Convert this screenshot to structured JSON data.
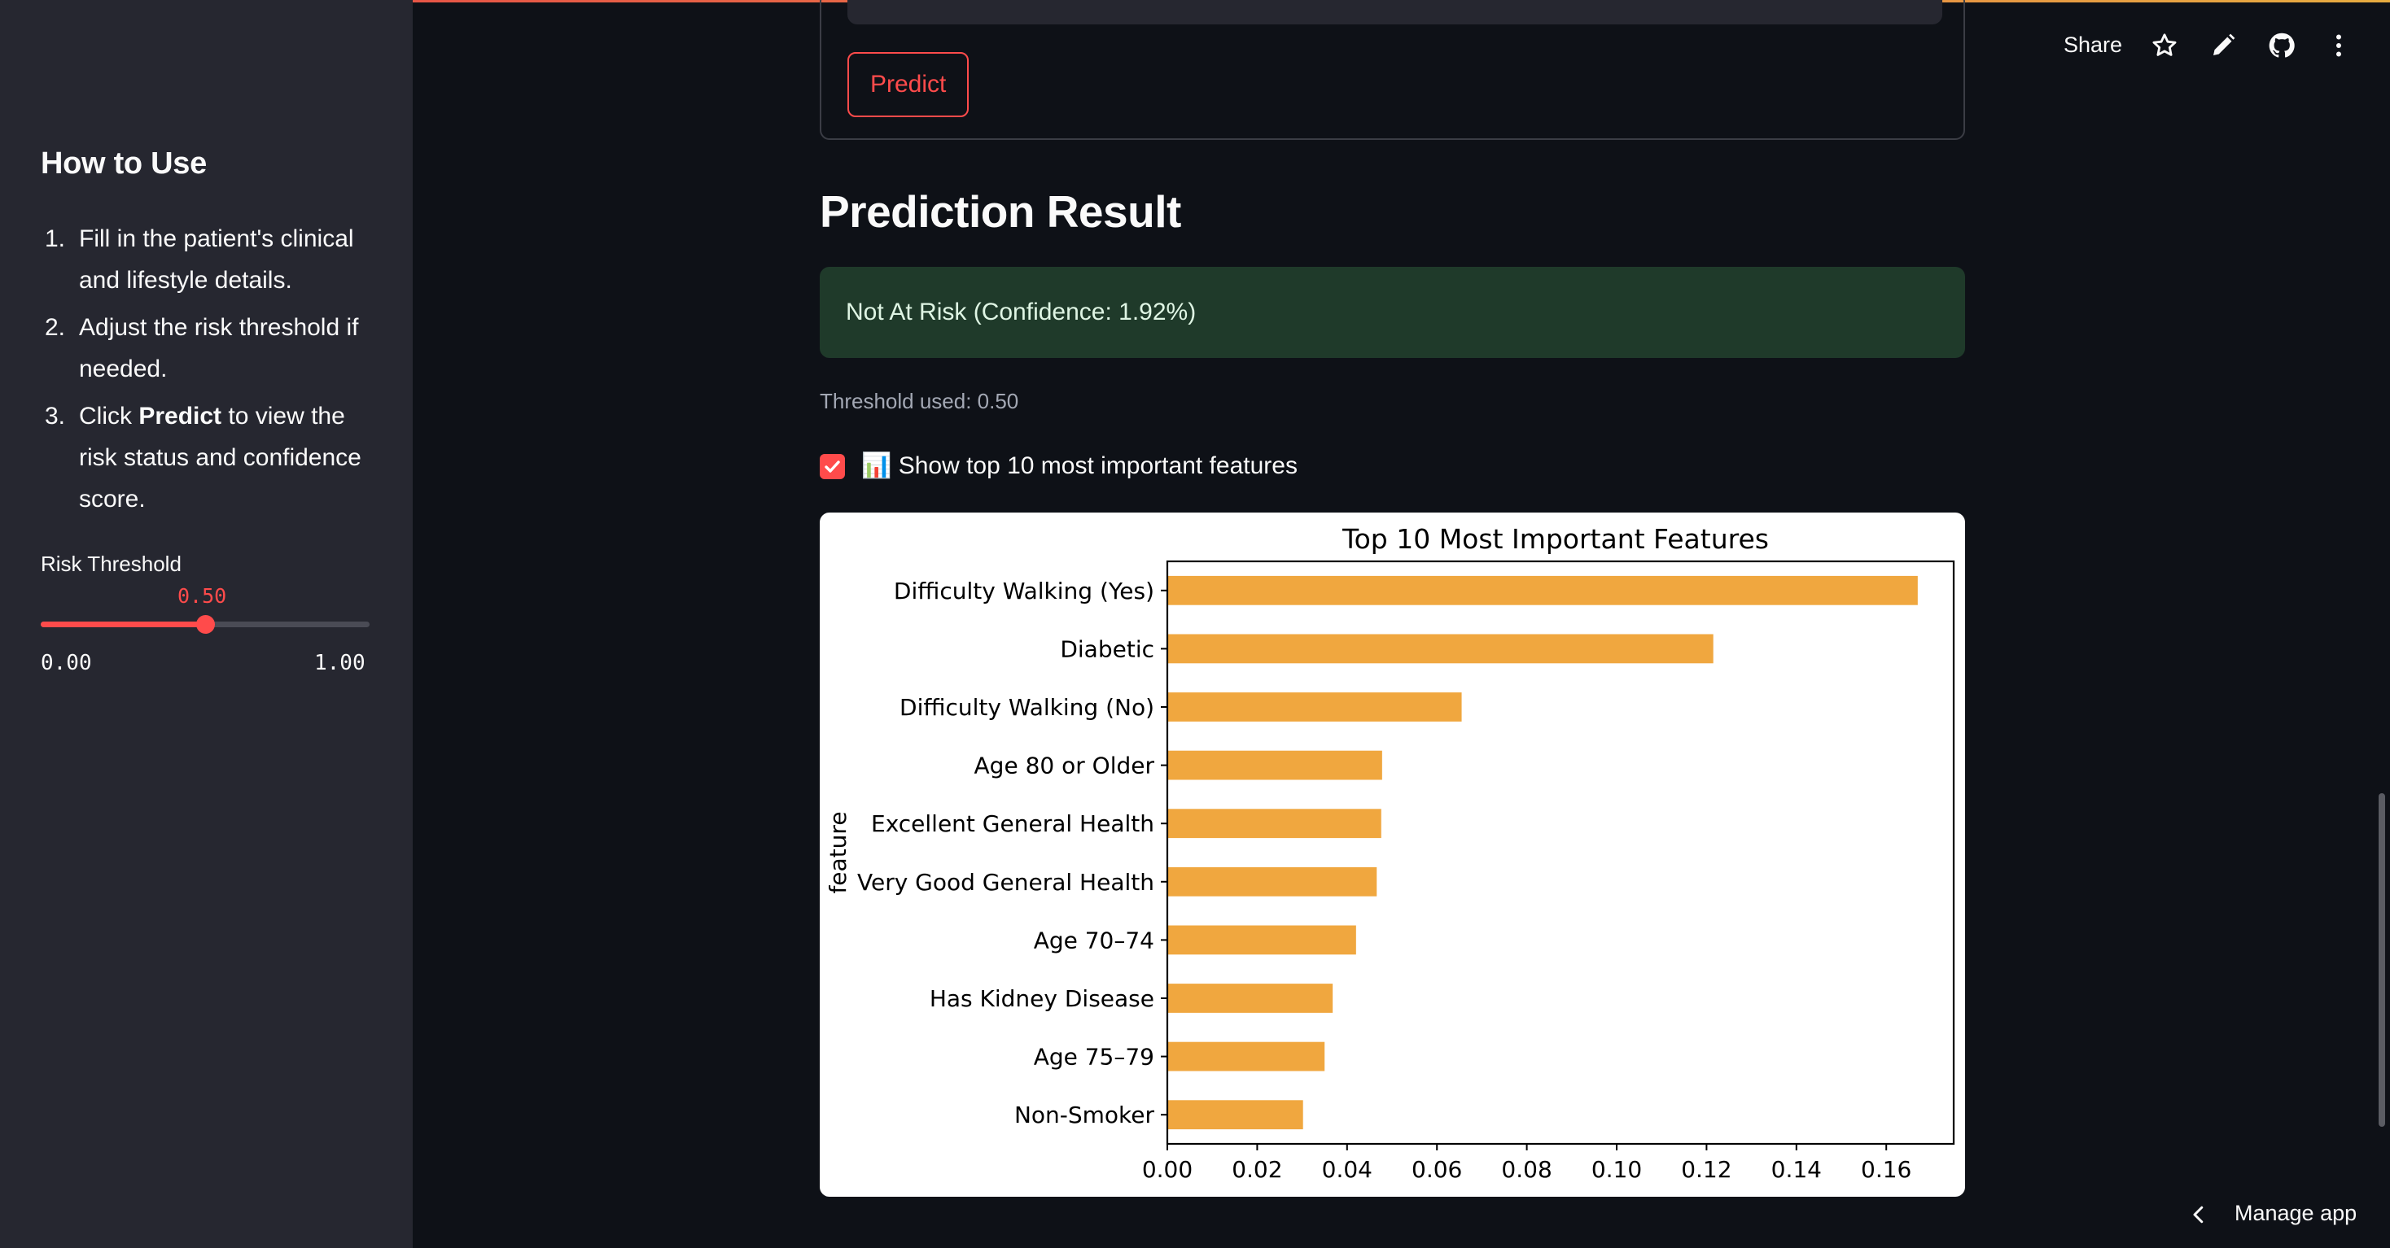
{
  "sidebar": {
    "title": "How to Use",
    "steps": [
      {
        "num": "1.",
        "pre": "Fill in the patient's clinical and lifestyle details.",
        "bold": "",
        "post": ""
      },
      {
        "num": "2.",
        "pre": "Adjust the risk threshold if needed.",
        "bold": "",
        "post": ""
      },
      {
        "num": "3.",
        "pre": "Click ",
        "bold": "Predict",
        "post": " to view the risk status and confidence score."
      }
    ],
    "slider": {
      "label": "Risk Threshold",
      "value": 0.5,
      "value_text": "0.50",
      "min_text": "0.00",
      "max_text": "1.00"
    }
  },
  "toolbar": {
    "share_label": "Share",
    "icons": [
      "star-icon",
      "pencil-icon",
      "github-icon",
      "more-vertical-icon"
    ]
  },
  "form": {
    "predict_label": "Predict"
  },
  "result": {
    "title": "Prediction Result",
    "message": "Not At Risk (Confidence: 1.92%)",
    "threshold_text": "Threshold used: 0.50",
    "alert_color": "#1f3a2a"
  },
  "features_toggle": {
    "checked": true,
    "label": "📊 Show top 10 most important features"
  },
  "chart_data": {
    "type": "bar",
    "orientation": "horizontal",
    "title": "Top 10 Most Important Features",
    "xlabel": "",
    "ylabel": "feature",
    "categories": [
      "Difficulty Walking (Yes)",
      "Diabetic",
      "Difficulty Walking (No)",
      "Age 80 or Older",
      "Excellent General Health",
      "Very Good General Health",
      "Age 70–74",
      "Has Kidney Disease",
      "Age 75–79",
      "Non-Smoker"
    ],
    "values": [
      0.167,
      0.1215,
      0.0655,
      0.0478,
      0.0476,
      0.0466,
      0.042,
      0.0368,
      0.035,
      0.0302
    ],
    "xticks": [
      "0.00",
      "0.02",
      "0.04",
      "0.06",
      "0.08",
      "0.10",
      "0.12",
      "0.14",
      "0.16"
    ],
    "xlim": [
      0,
      0.175
    ],
    "bar_color": "#f0a73f",
    "grid": false
  },
  "footer": {
    "manage_label": "Manage app"
  }
}
